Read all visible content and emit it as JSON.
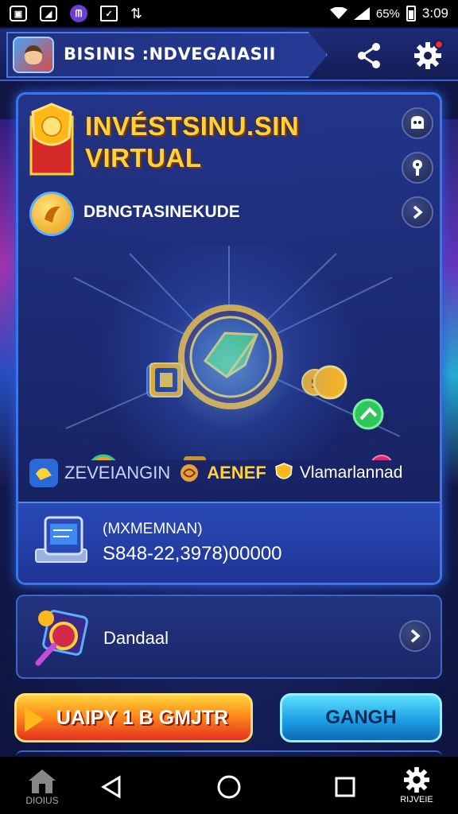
{
  "status_bar": {
    "battery": "65%",
    "time": "3:09"
  },
  "header": {
    "title": "BISINIS :NDVEGAIASII"
  },
  "card": {
    "title_line1": "INVÉSTSINU.SIN",
    "title_line2": "VIRTUAL",
    "subtitle": "DBNGTASINEKUDE"
  },
  "stats": {
    "item1": "ZEVEIANGIN",
    "item2": "AENEF",
    "item3": "Vlamarlannad"
  },
  "amount": {
    "label": "(MXMEMNAN)",
    "value": "S848-22,3978)00000"
  },
  "secondary": {
    "label": "Dandaal"
  },
  "actions": {
    "primary_label": "UAIPY 1 B GMJTR",
    "secondary_label": "GANGH"
  },
  "navbar": {
    "home_label": "DIOIUS",
    "right_label": "RIJVEIE"
  },
  "colors": {
    "accent_gold": "#ffd23a",
    "accent_blue": "#3d74e8",
    "primary_button": "#ff8a1a",
    "secondary_button": "#1a9ae0"
  }
}
